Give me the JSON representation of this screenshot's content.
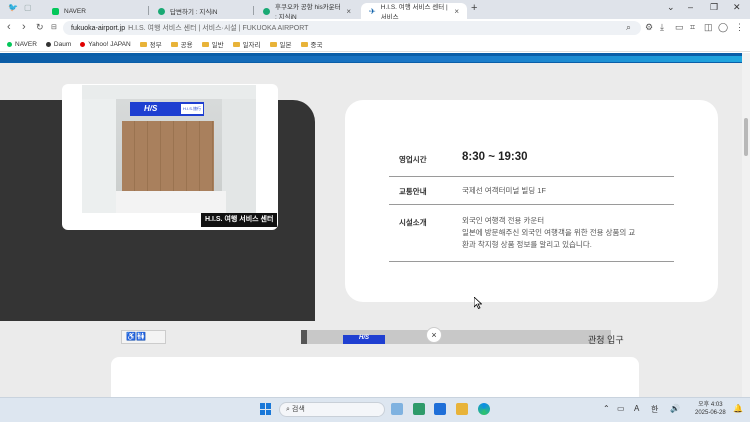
{
  "browser": {
    "tabs": [
      {
        "label": "NAVER",
        "favicon_color": "#03c75a"
      },
      {
        "label": "답변하기 : 지식iN",
        "favicon_color": "#19a974"
      },
      {
        "label": "후쿠오카 공항 his카운터 : 지식iN",
        "favicon_color": "#19a974"
      },
      {
        "label": "H.I.S. 여행 서비스 센터 | 서비스",
        "favicon_color": "#0a5ea8",
        "active": true
      }
    ],
    "url_host": "fukuoka-airport.jp",
    "url_title": "H.I.S. 여행 서비스 센터 | 서비스·시설 | FUKUOKA AIRPORT",
    "bookmarks": [
      {
        "label": "NAVER",
        "kind": "dot",
        "color": "#03c75a"
      },
      {
        "label": "Daum",
        "kind": "dot",
        "color": "#333333"
      },
      {
        "label": "Yahoo! JAPAN",
        "kind": "dot",
        "color": "#e00000"
      },
      {
        "label": "정부",
        "kind": "folder"
      },
      {
        "label": "공용",
        "kind": "folder"
      },
      {
        "label": "일반",
        "kind": "folder"
      },
      {
        "label": "일자리",
        "kind": "folder"
      },
      {
        "label": "일본",
        "kind": "folder"
      },
      {
        "label": "중국",
        "kind": "folder"
      }
    ]
  },
  "page": {
    "photo_caption": "H.I.S. 여행 서비스 센터",
    "photo_sign_logo": "H/S",
    "photo_sign_right": "H.I.S.旅行",
    "info": {
      "hours_label": "영업시간",
      "hours_value": "8:30 ~ 19:30",
      "access_label": "교통안내",
      "access_value": "국제선 여객터미널 빌딩 1F",
      "intro_label": "시설소개",
      "intro_line1": "외국인 여행객 전용 카운터",
      "intro_line2": "일본에 방문해주신 외국인 여행객을 위한 전용 상품의 교",
      "intro_line3": "환과 착지형 상품 정보를 알리고 있습니다."
    },
    "bottom_icons": "♿🚻",
    "bottom_close": "×",
    "bottom_sign": "H/S",
    "bottom_entrance": "관청 입구"
  },
  "taskbar": {
    "search_placeholder": "검색",
    "tray_lang": "A",
    "tray_ime": "한",
    "clock_line1": "오후 4:03",
    "clock_line2": "2025-06-28"
  }
}
